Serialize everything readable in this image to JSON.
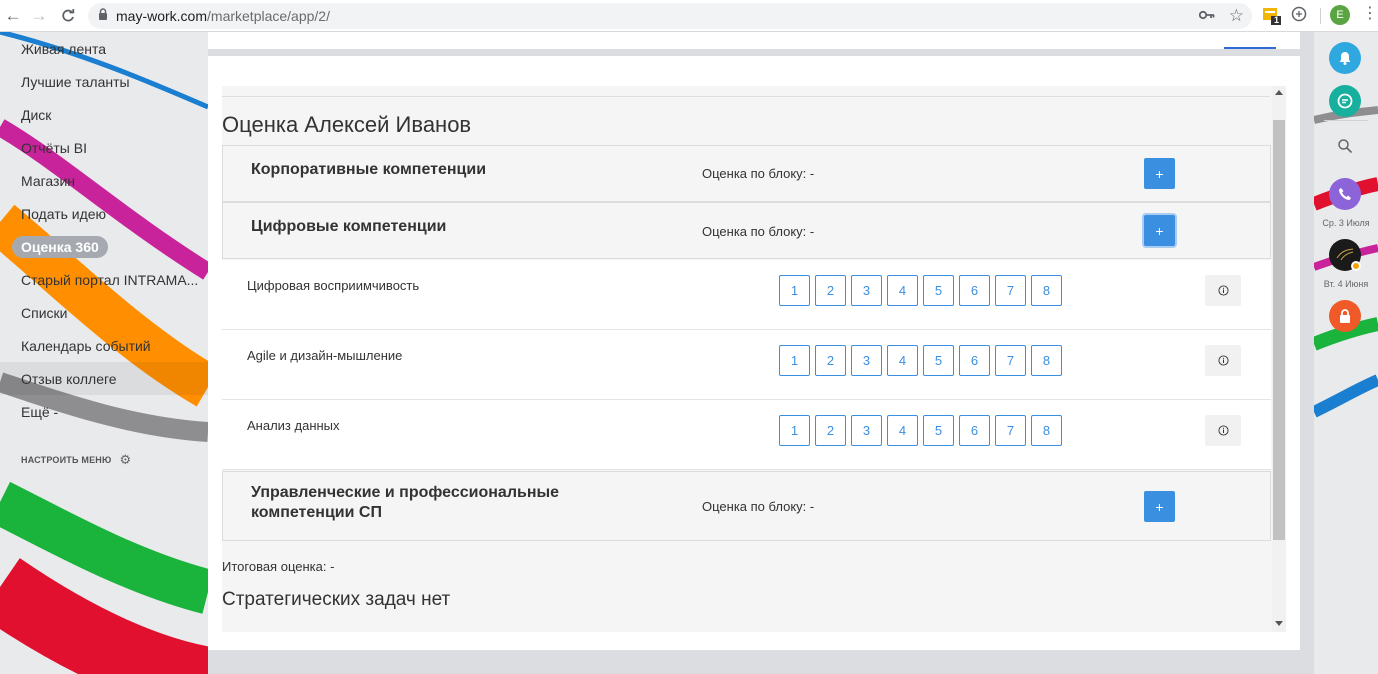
{
  "browser": {
    "url_host": "may-work.com",
    "url_path": "/marketplace/app/2/",
    "profile_initial": "E",
    "ext_badge": "1"
  },
  "sidebar": {
    "items": [
      {
        "label": "Живая лента"
      },
      {
        "label": "Лучшие таланты"
      },
      {
        "label": "Диск"
      },
      {
        "label": "Отчёты BI"
      },
      {
        "label": "Магазин"
      },
      {
        "label": "Подать идею"
      },
      {
        "label": "Оценка 360"
      },
      {
        "label": "Старый портал INTRAMA..."
      },
      {
        "label": "Списки"
      },
      {
        "label": "Календарь событий"
      },
      {
        "label": "Отзыв коллеге"
      },
      {
        "label": "Ещё -"
      }
    ],
    "configure_label": "НАСТРОИТЬ МЕНЮ"
  },
  "main": {
    "title": "Оценка Алексей Иванов",
    "blocks": [
      {
        "title_line1": "Корпоративные компетенции",
        "title_line2": "",
        "score_label": "Оценка по блоку: -",
        "button": "+"
      },
      {
        "title_line1": "Цифровые компетенции",
        "title_line2": "",
        "score_label": "Оценка по блоку: -",
        "button": "+"
      },
      {
        "title_line1": "Управленческие и профессиональные",
        "title_line2": "компетенции СП",
        "score_label": "Оценка по блоку: -",
        "button": "+"
      }
    ],
    "rows": [
      {
        "label": "Цифровая восприимчивость"
      },
      {
        "label": "Agile и дизайн-мышление"
      },
      {
        "label": "Анализ данных"
      }
    ],
    "scores": [
      "1",
      "2",
      "3",
      "4",
      "5",
      "6",
      "7",
      "8"
    ],
    "total_label": "Итоговая оценка: -",
    "strategic_label": "Стратегических задач нет"
  },
  "right_sidebar": {
    "call_date": "Ср. 3 Июля",
    "chat_date": "Вт. 4 Июня"
  },
  "colors": {
    "accent": "#3b8fe0",
    "wave_blue": "#1a7fd0",
    "wave_magenta": "#c8239a",
    "wave_orange": "#ff8f00",
    "wave_gray": "#8e8e90",
    "wave_green": "#1ab33c",
    "wave_red": "#e0102e"
  }
}
